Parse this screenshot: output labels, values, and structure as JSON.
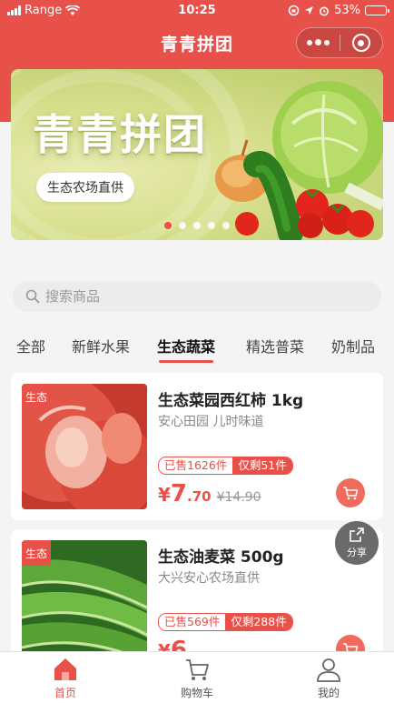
{
  "status": {
    "carrier": "Range",
    "time": "10:25",
    "battery": "53%",
    "battery_level": 0.53
  },
  "nav": {
    "title": "青青拼团"
  },
  "banner": {
    "title": "青青拼团",
    "pill": "生态农场直供",
    "slides": 5,
    "active_slide": 0
  },
  "search": {
    "placeholder": "搜索商品"
  },
  "tabs": [
    {
      "label": "全部",
      "active": false
    },
    {
      "label": "新鲜水果",
      "active": false
    },
    {
      "label": "生态蔬菜",
      "active": true
    },
    {
      "label": "精选普菜",
      "active": false
    },
    {
      "label": "奶制品",
      "active": false
    }
  ],
  "products": [
    {
      "tag": "生态",
      "name": "生态菜园西红柿 1kg",
      "sub": "安心田园 儿时味道",
      "sold": "已售1626件",
      "left": "仅剩51件",
      "price_symbol": "¥",
      "price_int": "7",
      "price_dec": ".70",
      "orig_price": "¥14.90"
    },
    {
      "tag": "生态",
      "name": "生态油麦菜 500g",
      "sub": "大兴安心农场直供",
      "sold": "已售569件",
      "left": "仅剩288件",
      "price_symbol": "¥",
      "price_int": "6",
      "price_dec": "",
      "orig_price": ""
    }
  ],
  "share": {
    "label": "分享"
  },
  "tabbar": [
    {
      "label": "首页",
      "icon": "home-icon",
      "active": true
    },
    {
      "label": "购物车",
      "icon": "cart-icon",
      "active": false
    },
    {
      "label": "我的",
      "icon": "user-icon",
      "active": false
    }
  ],
  "colors": {
    "accent": "#e8514a"
  }
}
